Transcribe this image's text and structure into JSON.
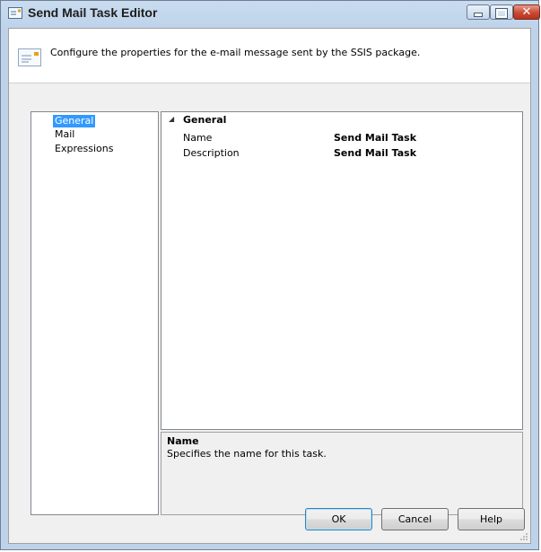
{
  "window": {
    "title": "Send Mail Task Editor",
    "icon": "mail-task-icon",
    "controls": [
      "minimize-icon",
      "maximize-icon",
      "close-icon"
    ]
  },
  "header": {
    "icon": "envelope-icon",
    "description": "Configure the properties for the e-mail message sent by the SSIS package."
  },
  "nav": {
    "items": [
      {
        "label": "General",
        "selected": true
      },
      {
        "label": "Mail",
        "selected": false
      },
      {
        "label": "Expressions",
        "selected": false
      }
    ]
  },
  "property_grid": {
    "category": "General",
    "rows": [
      {
        "name": "Name",
        "value": "Send Mail Task"
      },
      {
        "name": "Description",
        "value": "Send Mail Task"
      }
    ]
  },
  "help": {
    "title": "Name",
    "text": "Specifies the name for this task."
  },
  "buttons": {
    "ok": "OK",
    "cancel": "Cancel",
    "help": "Help"
  },
  "colors": {
    "selection": "#3399ff",
    "title_bar": "#c9dcef",
    "close_button": "#c94a34"
  }
}
